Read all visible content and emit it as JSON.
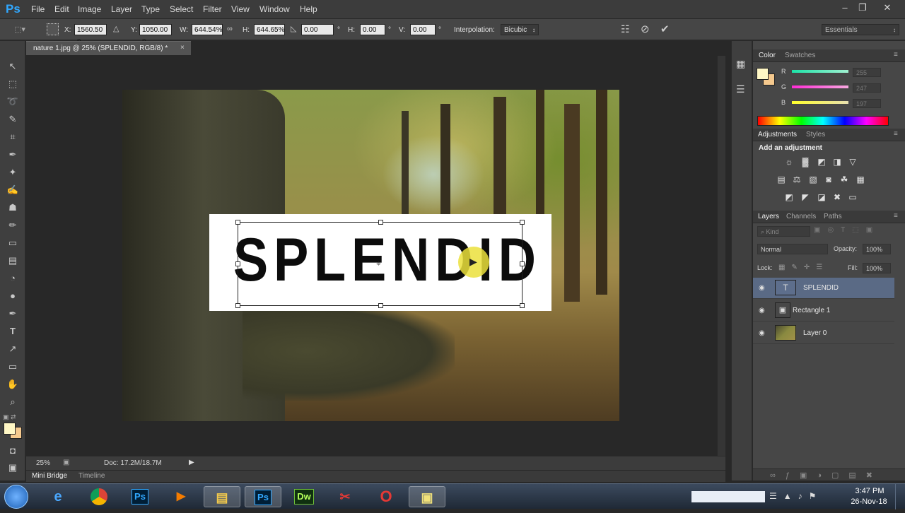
{
  "app": {
    "logo": "Ps"
  },
  "menu": [
    "File",
    "Edit",
    "Image",
    "Layer",
    "Type",
    "Select",
    "Filter",
    "View",
    "Window",
    "Help"
  ],
  "options": {
    "x_label": "X:",
    "x_value": "1560.50 p",
    "y_label": "Y:",
    "y_value": "1050.00 p",
    "w_label": "W:",
    "w_value": "644.54%",
    "h_label": "H:",
    "h_value": "644.65%",
    "angle_value": "0.00",
    "hskew_label": "H:",
    "hskew_value": "0.00",
    "vskew_label": "V:",
    "vskew_value": "0.00",
    "degree": "°",
    "interp_label": "Interpolation:",
    "interp_value": "Bicubic",
    "workspace": "Essentials"
  },
  "document": {
    "tab_title": "nature 1.jpg @ 25% (SPLENDID, RGB/8) *",
    "canvas_text": "SPLENDID"
  },
  "status": {
    "zoom": "25%",
    "doc_info": "Doc: 17.2M/18.7M"
  },
  "bottom_tabs": [
    "Mini Bridge",
    "Timeline"
  ],
  "color_panel": {
    "tabs": [
      "Color",
      "Swatches"
    ],
    "r_label": "R",
    "g_label": "G",
    "b_label": "B",
    "r_value": "255",
    "g_value": "247",
    "b_value": "197",
    "foreground": "#fff7c5",
    "background": "#f5c98e"
  },
  "adjustments_panel": {
    "tabs": [
      "Adjustments",
      "Styles"
    ],
    "heading": "Add an adjustment"
  },
  "layers_panel": {
    "tabs": [
      "Layers",
      "Channels",
      "Paths"
    ],
    "kind_label": "Kind",
    "blend_mode": "Normal",
    "opacity_label": "Opacity:",
    "opacity_value": "100%",
    "lock_label": "Lock:",
    "fill_label": "Fill:",
    "fill_value": "100%",
    "layers": [
      {
        "name": "SPLENDID",
        "type": "text",
        "selected": true
      },
      {
        "name": "Rectangle 1",
        "type": "shape",
        "selected": false
      },
      {
        "name": "Layer 0",
        "type": "image",
        "selected": false
      }
    ]
  },
  "taskbar": {
    "apps": [
      "internet-explorer",
      "chrome",
      "photoshop",
      "media-player",
      "file-explorer",
      "photoshop",
      "dreamweaver",
      "acrobat",
      "opera",
      "folder"
    ],
    "labels": {
      "ps": "Ps",
      "dw": "Dw"
    },
    "time": "3:47 PM",
    "date": "26-Nov-18"
  }
}
